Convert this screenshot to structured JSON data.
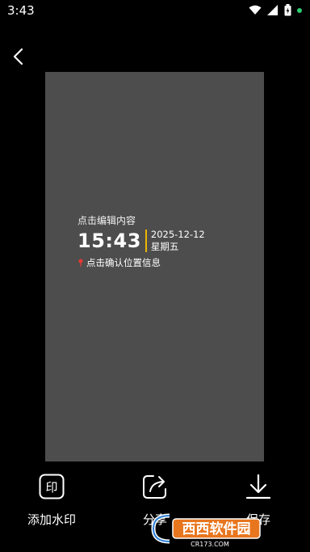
{
  "status": {
    "time": "3:43"
  },
  "watermark": {
    "title": "点击编辑内容",
    "time": "15:43",
    "date": "2025-12-12",
    "weekday": "星期五",
    "location": "点击确认位置信息"
  },
  "toolbar": {
    "add_watermark": "添加水印",
    "share": "分享",
    "save": "保存"
  },
  "logo": {
    "brand": "西西软件园",
    "domain": "CR173.COM"
  }
}
